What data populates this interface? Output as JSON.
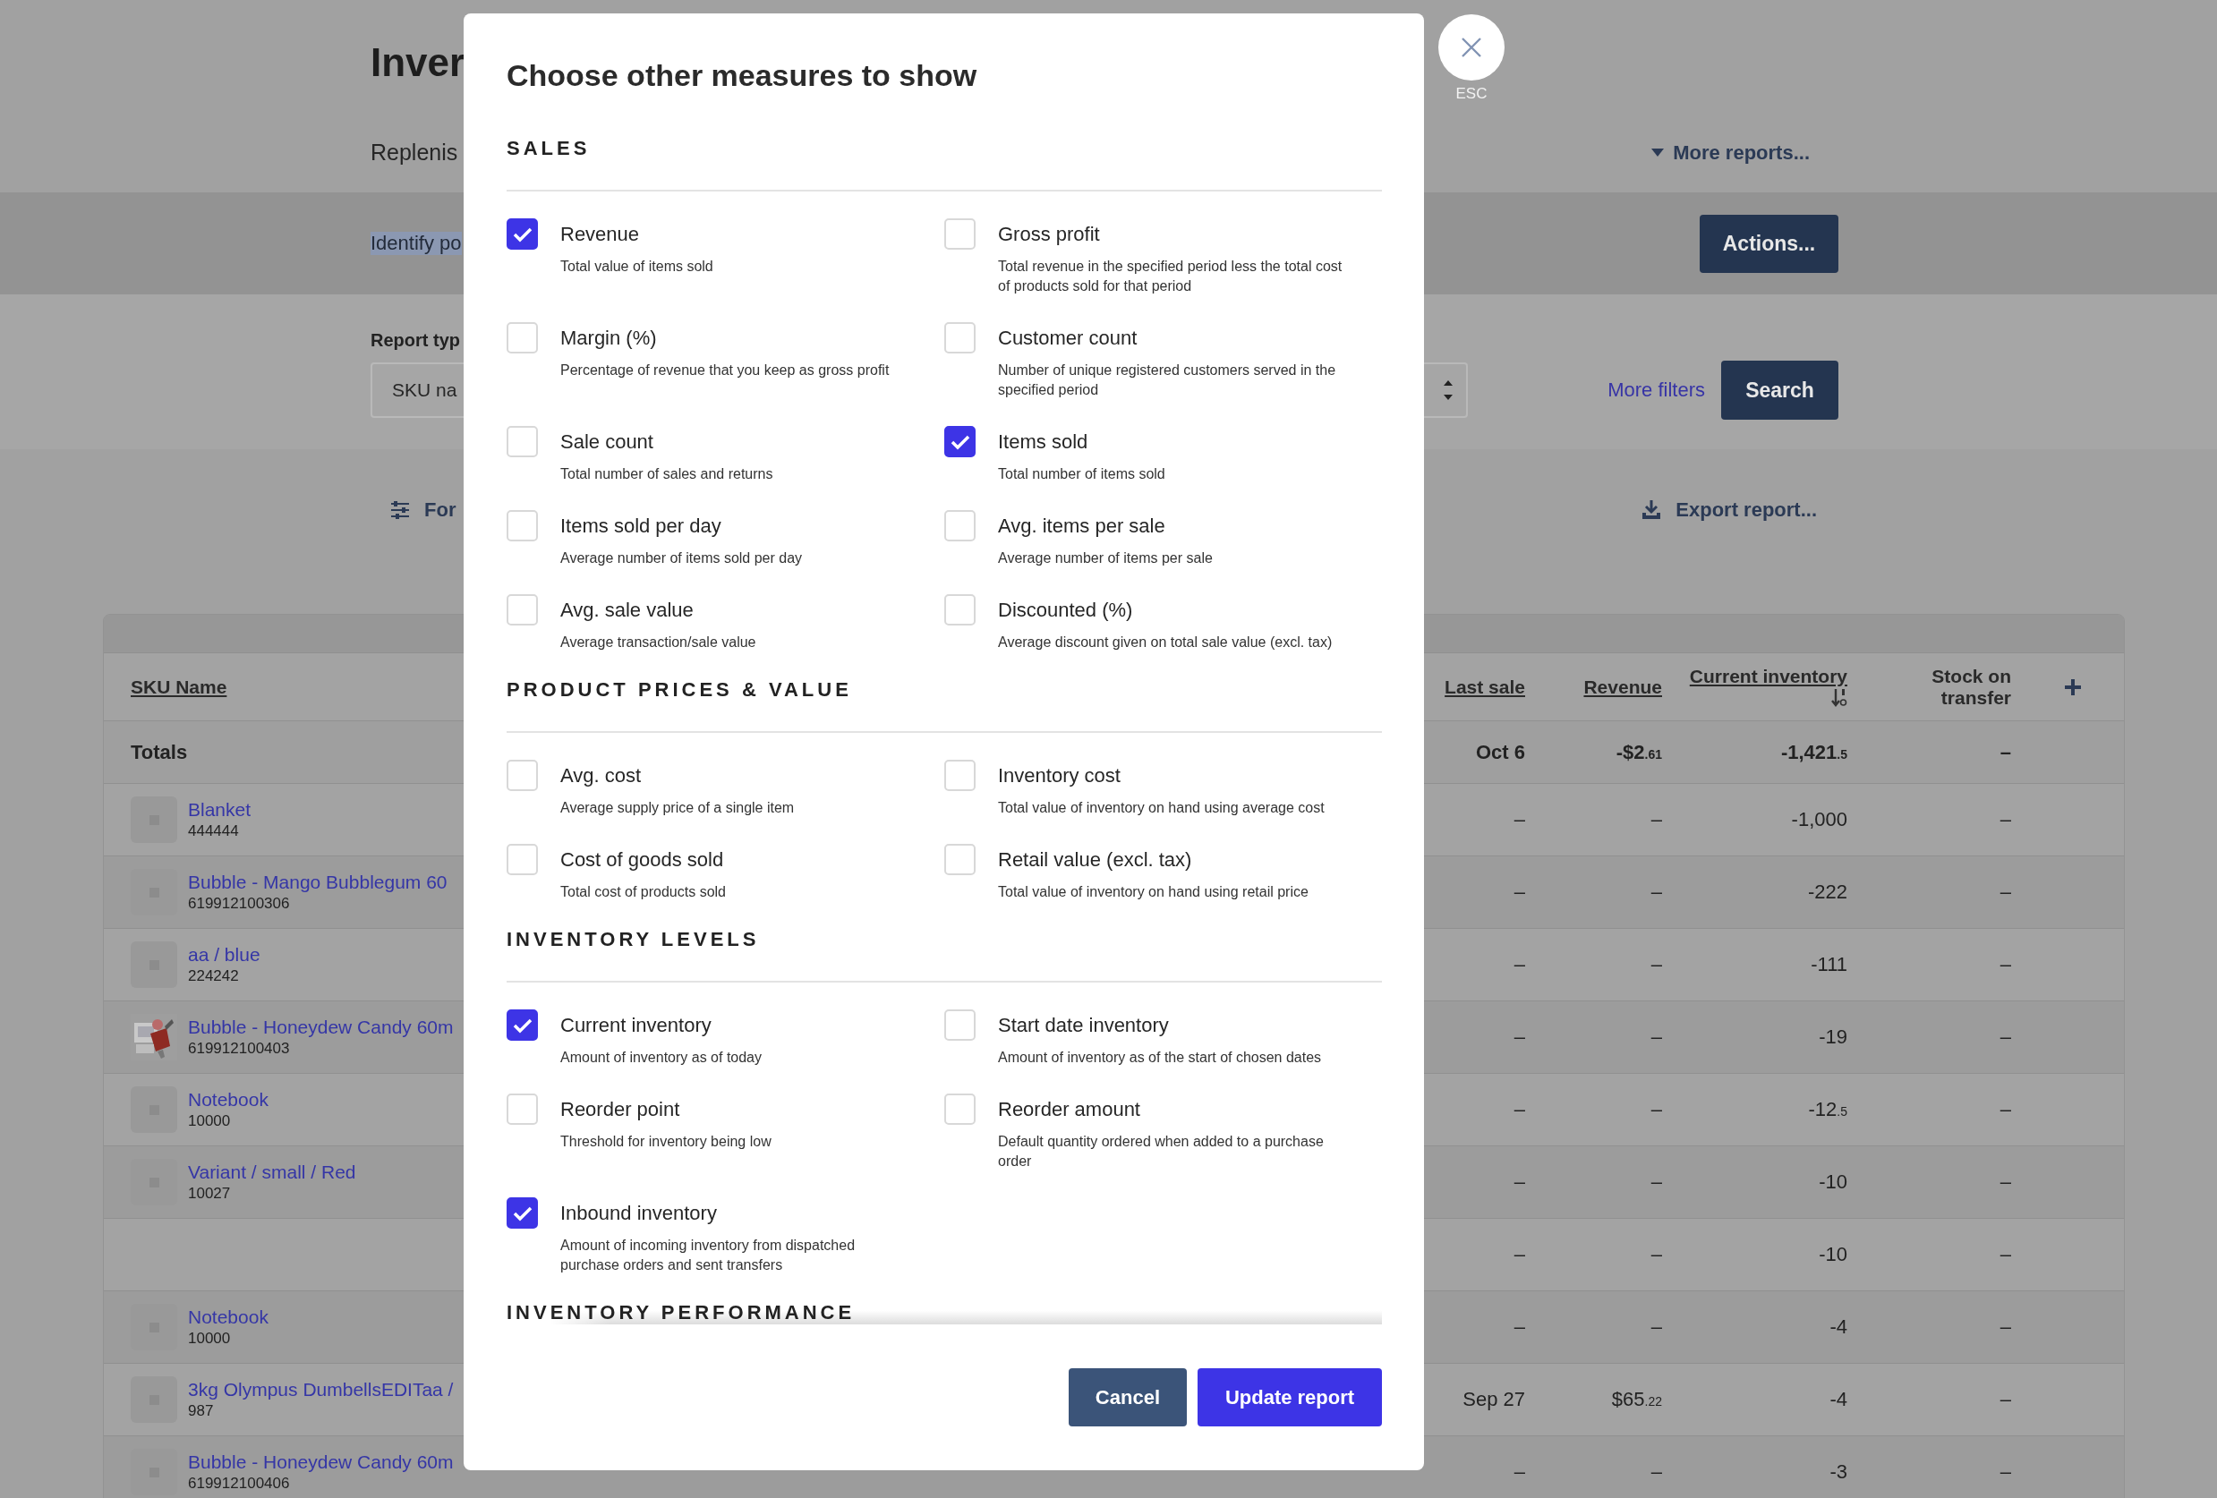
{
  "page": {
    "title": "Inver",
    "subtitle": "Replenis",
    "more_reports": "More reports...",
    "description": {
      "text": "Identify po",
      "highlighted": true
    },
    "actions_button": "Actions..."
  },
  "filters": {
    "label": "Report typ",
    "report_type": "SKU na",
    "more_filters": "More filters",
    "search_button": "Search"
  },
  "toolbar": {
    "format": "For",
    "export": "Export report..."
  },
  "table": {
    "columns": [
      {
        "label": "SKU Name",
        "sortable": true,
        "sorted": false
      },
      {
        "label": "Last sale",
        "sortable": true,
        "sorted": false
      },
      {
        "label": "Revenue",
        "sortable": true,
        "sorted": false
      },
      {
        "label": "Current inventory",
        "sortable": true,
        "sorted": true
      },
      {
        "label": "Stock on transfer",
        "sortable": false,
        "sorted": false
      }
    ],
    "totals": {
      "label": "Totals",
      "last_sale": "Oct 6",
      "revenue": {
        "whole": "-$2",
        "fraction": ".61"
      },
      "current_inventory": {
        "whole": "-1,421",
        "fraction": ".5"
      },
      "stock_on_transfer": "–"
    },
    "rows": [
      {
        "name": "Blanket",
        "sku": "444444",
        "thumbnail": {
          "kind": "placeholder"
        },
        "last_sale": "–",
        "revenue": {
          "whole": "–"
        },
        "current_inventory": {
          "whole": "-1,000"
        },
        "stock_on_transfer": "–"
      },
      {
        "name": "Bubble - Mango Bubblegum 60",
        "sku": "619912100306",
        "thumbnail": {
          "kind": "placeholder"
        },
        "last_sale": "–",
        "revenue": {
          "whole": "–"
        },
        "current_inventory": {
          "whole": "-222"
        },
        "stock_on_transfer": "–"
      },
      {
        "name": "aa / blue",
        "sku": "224242",
        "thumbnail": {
          "kind": "placeholder"
        },
        "last_sale": "–",
        "revenue": {
          "whole": "–"
        },
        "current_inventory": {
          "whole": "-111"
        },
        "stock_on_transfer": "–"
      },
      {
        "name": "Bubble - Honeydew Candy 60m",
        "sku": "619912100403",
        "last_sale": "–",
        "revenue": {
          "whole": "–"
        },
        "current_inventory": {
          "whole": "-19"
        },
        "stock_on_transfer": "–"
      },
      {
        "name": "Notebook",
        "sku": "10000",
        "thumbnail": {
          "kind": "placeholder"
        },
        "last_sale": "–",
        "revenue": {
          "whole": "–"
        },
        "current_inventory": {
          "whole": "-12",
          "fraction": ".5"
        },
        "stock_on_transfer": "–"
      },
      {
        "name": "Variant / small / Red",
        "sku": "10027",
        "thumbnail": {
          "kind": "placeholder"
        },
        "last_sale": "–",
        "revenue": {
          "whole": "–"
        },
        "current_inventory": {
          "whole": "-10"
        },
        "stock_on_transfer": "–"
      },
      {
        "last_sale": "–",
        "revenue": {
          "whole": "–"
        },
        "current_inventory": {
          "whole": "-10"
        },
        "stock_on_transfer": "–"
      },
      {
        "name": "Notebook",
        "sku": "10000",
        "thumbnail": {
          "kind": "placeholder"
        },
        "last_sale": "–",
        "revenue": {
          "whole": "–"
        },
        "current_inventory": {
          "whole": "-4"
        },
        "stock_on_transfer": "–"
      },
      {
        "name": "3kg Olympus DumbellsEDITaa /",
        "sku": "987",
        "thumbnail": {
          "kind": "placeholder"
        },
        "last_sale": "Sep 27",
        "revenue": {
          "whole": "$65",
          "fraction": ".22"
        },
        "current_inventory": {
          "whole": "-4"
        },
        "stock_on_transfer": "–"
      },
      {
        "name": "Bubble - Honeydew Candy 60m",
        "sku": "619912100406",
        "thumbnail": {
          "kind": "placeholder"
        },
        "last_sale": "–",
        "revenue": {
          "whole": "–"
        },
        "current_inventory": {
          "whole": "-3"
        },
        "stock_on_transfer": "–"
      }
    ]
  },
  "dialog": {
    "title": "Choose other measures to show",
    "close_hint": "ESC",
    "sections": [
      {
        "heading": "SALES",
        "measures": [
          {
            "label": "Revenue",
            "description": "Total value of items sold",
            "checked": true
          },
          {
            "label": "Gross profit",
            "description": "Total revenue in the specified period less the total cost of products sold for that period",
            "checked": false
          },
          {
            "label": "Margin (%)",
            "description": "Percentage of revenue that you keep as gross profit",
            "checked": false
          },
          {
            "label": "Customer count",
            "description": "Number of unique registered customers served in the specified period",
            "checked": false
          },
          {
            "label": "Sale count",
            "description": "Total number of sales and returns",
            "checked": false
          },
          {
            "label": "Items sold",
            "description": "Total number of items sold",
            "checked": true
          },
          {
            "label": "Items sold per day",
            "description": "Average number of items sold per day",
            "checked": false
          },
          {
            "label": "Avg. items per sale",
            "description": "Average number of items per sale",
            "checked": false
          },
          {
            "label": "Avg. sale value",
            "description": "Average transaction/sale value",
            "checked": false
          },
          {
            "label": "Discounted (%)",
            "description": "Average discount given on total sale value (excl. tax)",
            "checked": false
          }
        ]
      },
      {
        "heading": "PRODUCT PRICES & VALUE",
        "measures": [
          {
            "label": "Avg. cost",
            "description": "Average supply price of a single item",
            "checked": false
          },
          {
            "label": "Inventory cost",
            "description": "Total value of inventory on hand using average cost",
            "checked": false
          },
          {
            "label": "Cost of goods sold",
            "description": "Total cost of products sold",
            "checked": false
          },
          {
            "label": "Retail value (excl. tax)",
            "description": "Total value of inventory on hand using retail price",
            "checked": false
          }
        ]
      },
      {
        "heading": "INVENTORY LEVELS",
        "measures": [
          {
            "label": "Current inventory",
            "description": "Amount of inventory as of today",
            "checked": true
          },
          {
            "label": "Start date inventory",
            "description": "Amount of inventory as of the start of chosen dates",
            "checked": false
          },
          {
            "label": "Reorder point",
            "description": "Threshold for inventory being low",
            "checked": false
          },
          {
            "label": "Reorder amount",
            "description": "Default quantity ordered when added to a purchase order",
            "checked": false
          },
          {
            "label": "Inbound inventory",
            "description": "Amount of incoming inventory from dispatched purchase orders and sent transfers",
            "checked": true
          }
        ]
      },
      {
        "heading": "INVENTORY PERFORMANCE"
      }
    ],
    "buttons": [
      {
        "label": "Cancel",
        "kind": "secondary"
      },
      {
        "label": "Update report",
        "kind": "primary"
      }
    ]
  }
}
